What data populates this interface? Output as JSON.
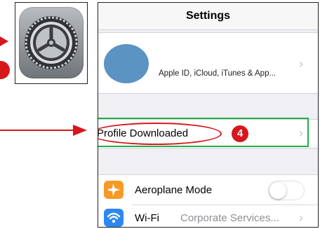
{
  "annotations": {
    "step_badge_right": "4"
  },
  "settings": {
    "title": "Settings",
    "apple_id_text": "Apple ID, iCloud, iTunes & App...",
    "profile_downloaded_label": "Profile Downloaded",
    "aeroplane_label": "Aeroplane Mode",
    "aeroplane_on": false,
    "wifi_label": "Wi-Fi",
    "wifi_value": "Corporate Services...",
    "chevron": "›"
  },
  "colors": {
    "annotation_red": "#d6171c",
    "highlight_green": "#1fae4a",
    "aeroplane_icon": "#f69a26",
    "wifi_icon": "#2d87f2"
  },
  "icons": {
    "app": "settings-gear-icon",
    "aeroplane": "aeroplane-icon",
    "wifi": "wifi-icon"
  }
}
